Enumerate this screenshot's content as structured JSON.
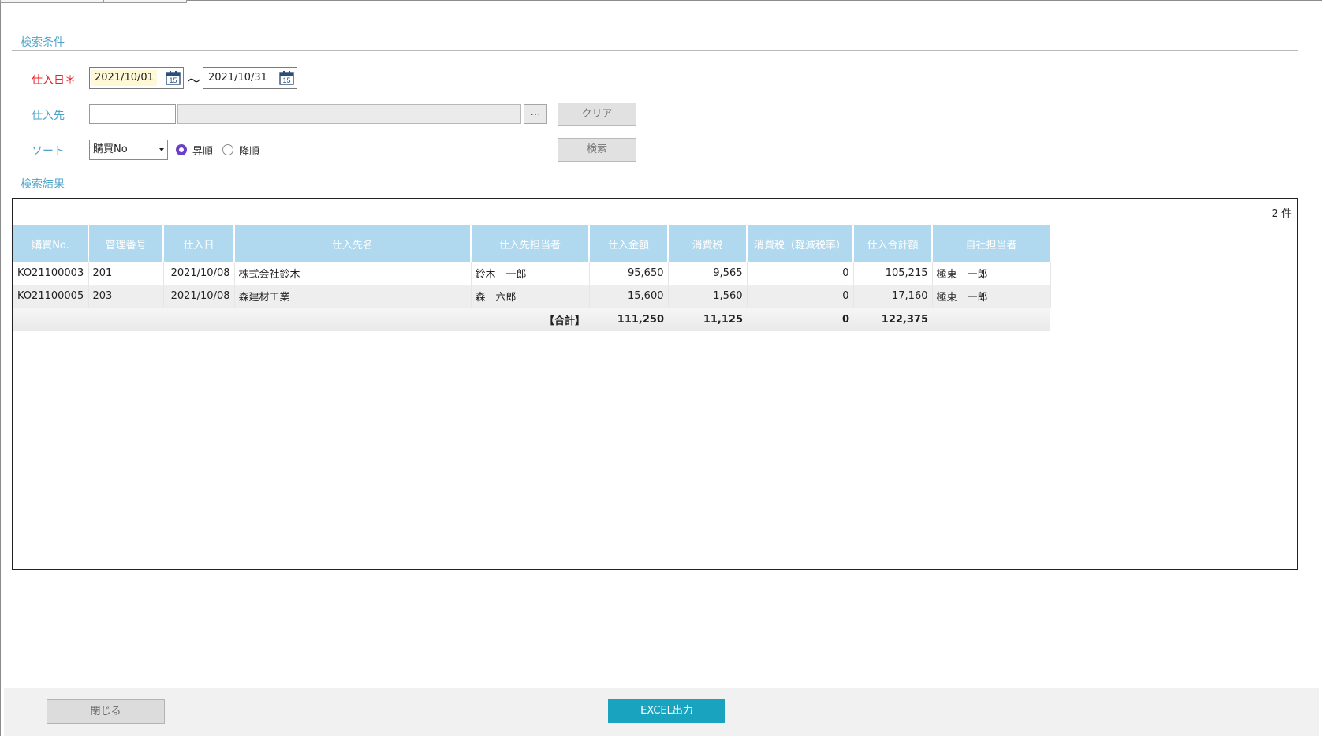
{
  "criteria": {
    "section_title": "検索条件",
    "purchase_date": {
      "label": "仕入日＊",
      "from": "2021/10/01",
      "to": "2021/10/31",
      "separator": "～",
      "calendar_icon_text": "15"
    },
    "supplier": {
      "label": "仕入先",
      "code_value": "",
      "name_value": "",
      "lookup_label": "…",
      "clear_label": "クリア"
    },
    "sort": {
      "label": "ソート",
      "selected": "購買No",
      "ascending_label": "昇順",
      "descending_label": "降順",
      "order": "ascending",
      "search_label": "検索"
    }
  },
  "results": {
    "section_title": "検索結果",
    "count_label": "2 件",
    "columns": [
      "購買No.",
      "管理番号",
      "仕入日",
      "仕入先名",
      "仕入先担当者",
      "仕入金額",
      "消費税",
      "消費税（軽減税率）",
      "仕入合計額",
      "自社担当者"
    ],
    "rows": [
      {
        "purchase_no": "KO21100003",
        "mgmt_no": "201",
        "date": "2021/10/08",
        "supplier": "株式会社鈴木",
        "supplier_contact": "鈴木　一郎",
        "amount": "95,650",
        "tax": "9,565",
        "reduced_tax": "0",
        "total": "105,215",
        "staff": "極東　一郎"
      },
      {
        "purchase_no": "KO21100005",
        "mgmt_no": "203",
        "date": "2021/10/08",
        "supplier": "森建材工業",
        "supplier_contact": "森　六郎",
        "amount": "15,600",
        "tax": "1,560",
        "reduced_tax": "0",
        "total": "17,160",
        "staff": "極東　一郎"
      }
    ],
    "totals": {
      "label": "【合計】",
      "amount": "111,250",
      "tax": "11,125",
      "reduced_tax": "0",
      "total": "122,375"
    }
  },
  "footer": {
    "close_label": "閉じる",
    "excel_label": "EXCEL出力"
  },
  "colors": {
    "accent_label": "#4aa3c8",
    "required_label": "#e8232a",
    "header_bg": "#b0d8ee",
    "excel_button": "#1aa3bf",
    "radio_selected": "#6b3fc7"
  }
}
